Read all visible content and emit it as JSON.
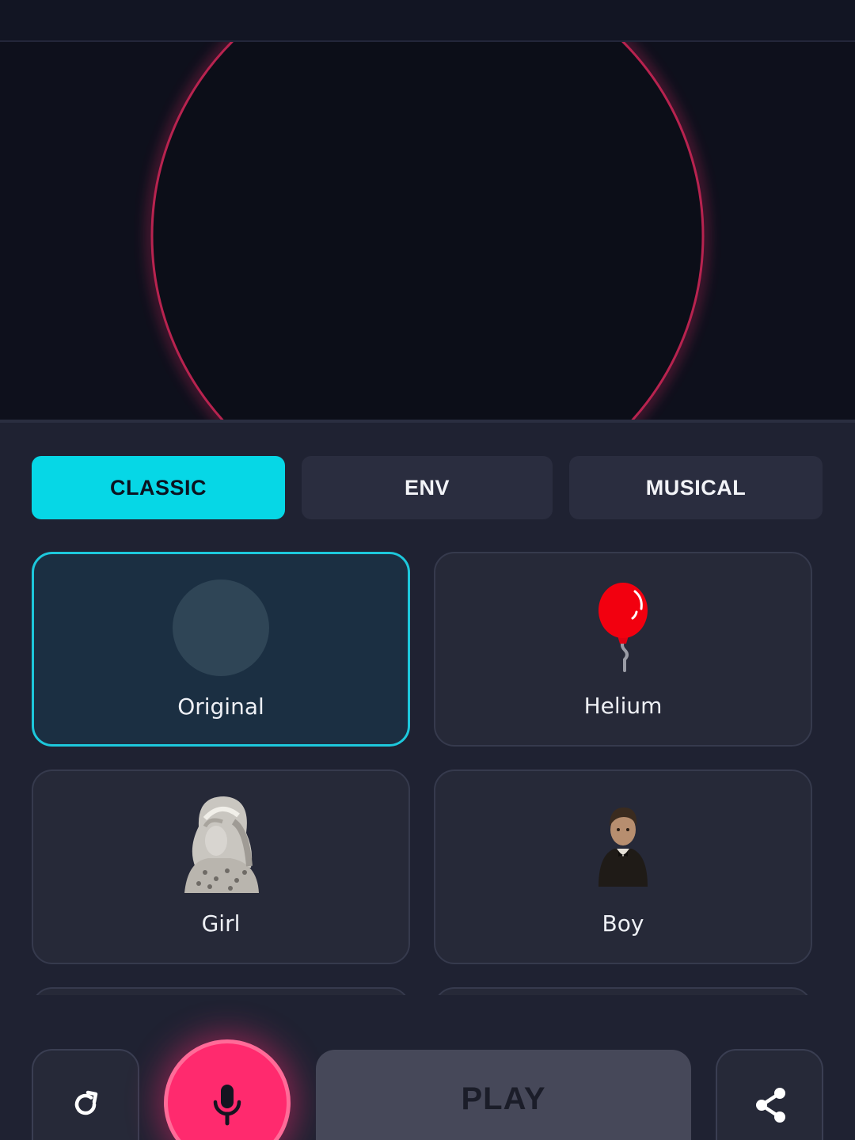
{
  "colors": {
    "accent": "#06d7e6",
    "record": "#ff2a6e",
    "background": "#1f2232",
    "card": "#262938",
    "selected_card": "#1b2f42",
    "visualizer_ring": "#d6285f"
  },
  "tabs": [
    {
      "label": "CLASSIC",
      "active": true
    },
    {
      "label": "ENV",
      "active": false
    },
    {
      "label": "MUSICAL",
      "active": false
    }
  ],
  "effects": [
    {
      "label": "Original",
      "icon": "original-circle-icon",
      "selected": true
    },
    {
      "label": "Helium",
      "icon": "balloon-icon",
      "selected": false
    },
    {
      "label": "Girl",
      "icon": "girl-photo",
      "selected": false
    },
    {
      "label": "Boy",
      "icon": "boy-photo",
      "selected": false
    }
  ],
  "controls": {
    "reset_icon": "refresh-icon",
    "record_icon": "microphone-icon",
    "play_label": "PLAY",
    "share_icon": "share-icon"
  }
}
